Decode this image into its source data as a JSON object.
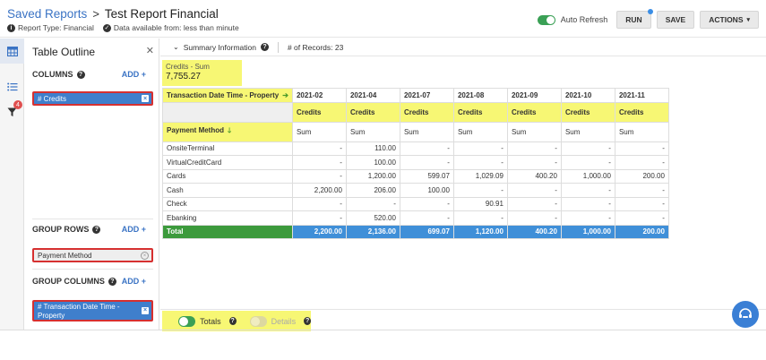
{
  "header": {
    "breadcrumb_root": "Saved Reports",
    "breadcrumb_sep": ">",
    "title": "Test Report Financial",
    "report_type": "Report Type: Financial",
    "data_available": "Data available from: less than minute",
    "auto_refresh_label": "Auto Refresh",
    "run_label": "RUN",
    "save_label": "SAVE",
    "actions_label": "ACTIONS"
  },
  "rail": {
    "filter_badge": "4"
  },
  "outline": {
    "title": "Table Outline",
    "columns_label": "COLUMNS",
    "group_rows_label": "GROUP ROWS",
    "group_columns_label": "GROUP COLUMNS",
    "add_label": "ADD +",
    "column_pill": "# Credits",
    "group_row_pill": "Payment Method",
    "group_column_pill": "# Transaction Date Time - Property"
  },
  "summary": {
    "label": "Summary Information",
    "records": "# of Records: 23",
    "credits_sum_label": "Credits - Sum",
    "credits_sum_value": "7,755.27"
  },
  "table": {
    "col_group_header": "Transaction Date Time - Property",
    "row_group_header": "Payment Method",
    "columns": [
      "2021-02",
      "2021-04",
      "2021-07",
      "2021-08",
      "2021-09",
      "2021-10",
      "2021-11"
    ],
    "measure_label": "Credits",
    "agg_label": "Sum",
    "rows": [
      {
        "name": "OnsiteTerminal",
        "values": [
          "-",
          "110.00",
          "-",
          "-",
          "-",
          "-",
          "-"
        ]
      },
      {
        "name": "VirtualCreditCard",
        "values": [
          "-",
          "100.00",
          "-",
          "-",
          "-",
          "-",
          "-"
        ]
      },
      {
        "name": "Cards",
        "values": [
          "-",
          "1,200.00",
          "599.07",
          "1,029.09",
          "400.20",
          "1,000.00",
          "200.00"
        ]
      },
      {
        "name": "Cash",
        "values": [
          "2,200.00",
          "206.00",
          "100.00",
          "-",
          "-",
          "-",
          "-"
        ]
      },
      {
        "name": "Check",
        "values": [
          "-",
          "-",
          "-",
          "90.91",
          "-",
          "-",
          "-"
        ]
      },
      {
        "name": "Ebanking",
        "values": [
          "-",
          "520.00",
          "-",
          "-",
          "-",
          "-",
          "-"
        ]
      }
    ],
    "total": {
      "name": "Total",
      "values": [
        "2,200.00",
        "2,136.00",
        "699.07",
        "1,120.00",
        "400.20",
        "1,000.00",
        "200.00"
      ]
    }
  },
  "footer": {
    "totals_label": "Totals",
    "details_label": "Details"
  },
  "colors": {
    "accent": "#3f7fcc",
    "highlight": "#f7f774",
    "total_green": "#3c9a3c",
    "toggle_on": "#3aa055"
  }
}
